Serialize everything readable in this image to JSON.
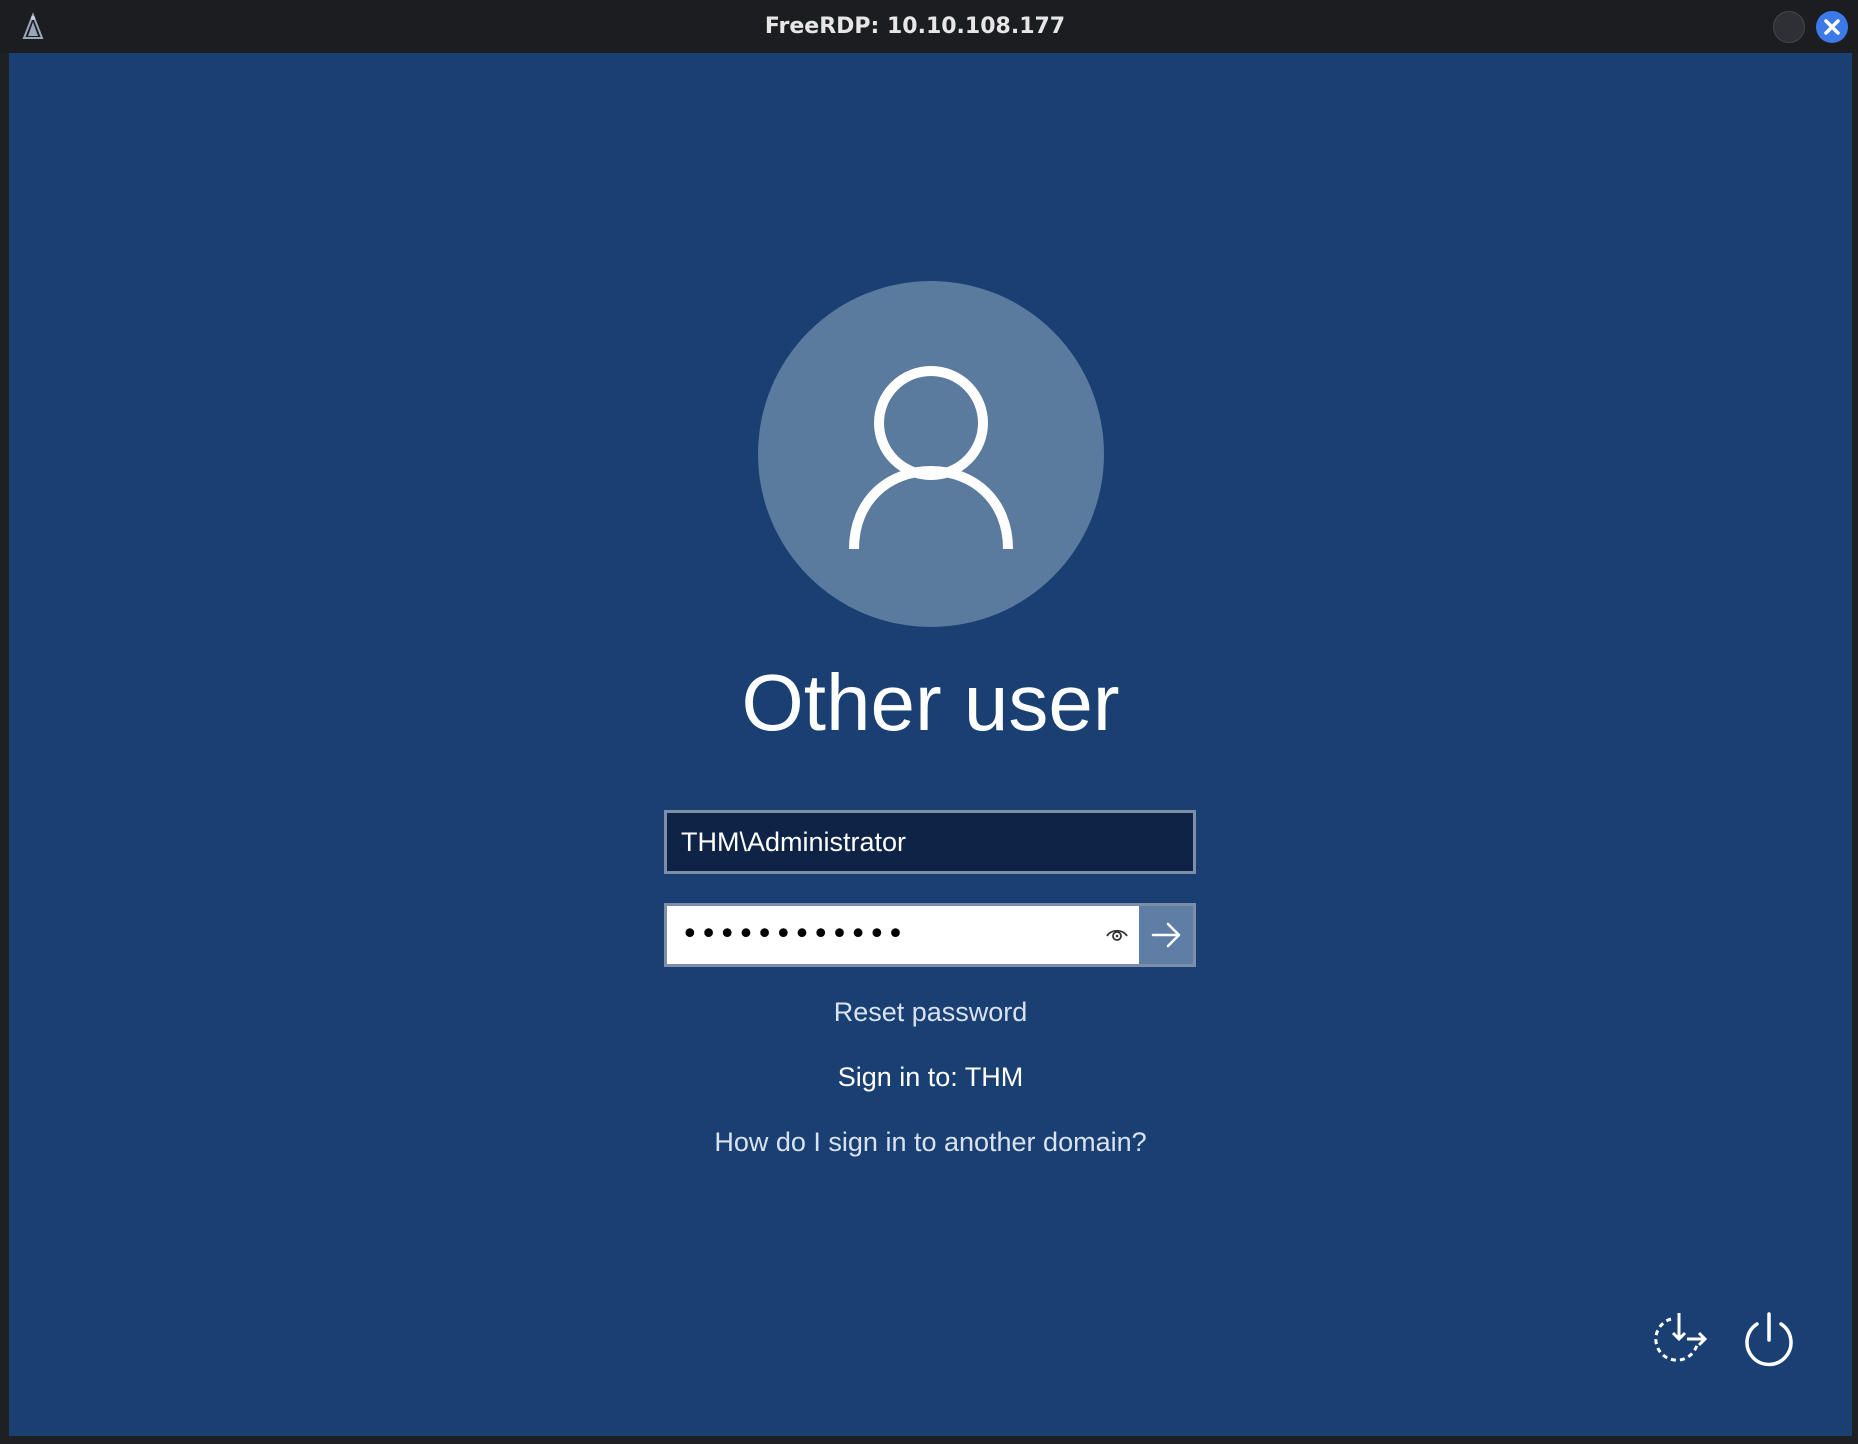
{
  "window": {
    "title": "FreeRDP: 10.10.108.177",
    "app_icon": "freerdp-icon",
    "close_icon": "close-icon",
    "minimize_icon": "minimize-icon"
  },
  "login": {
    "user_name": "Other user",
    "avatar_icon": "user-icon",
    "username_value": "THM\\Administrator",
    "password_value": "••••••••••••",
    "reveal_icon": "eye-icon",
    "submit_icon": "arrow-right-icon",
    "reset_password": "Reset password",
    "sign_in_to": "Sign in to: THM",
    "other_domain": "How do I sign in to another domain?"
  },
  "corner": {
    "ease_of_access_icon": "ease-of-access-icon",
    "power_icon": "power-icon"
  },
  "colors": {
    "background": "#1a3f72",
    "avatar": "#5a7a9e",
    "submit": "#5e7ea6",
    "close": "#3d7ae8"
  }
}
